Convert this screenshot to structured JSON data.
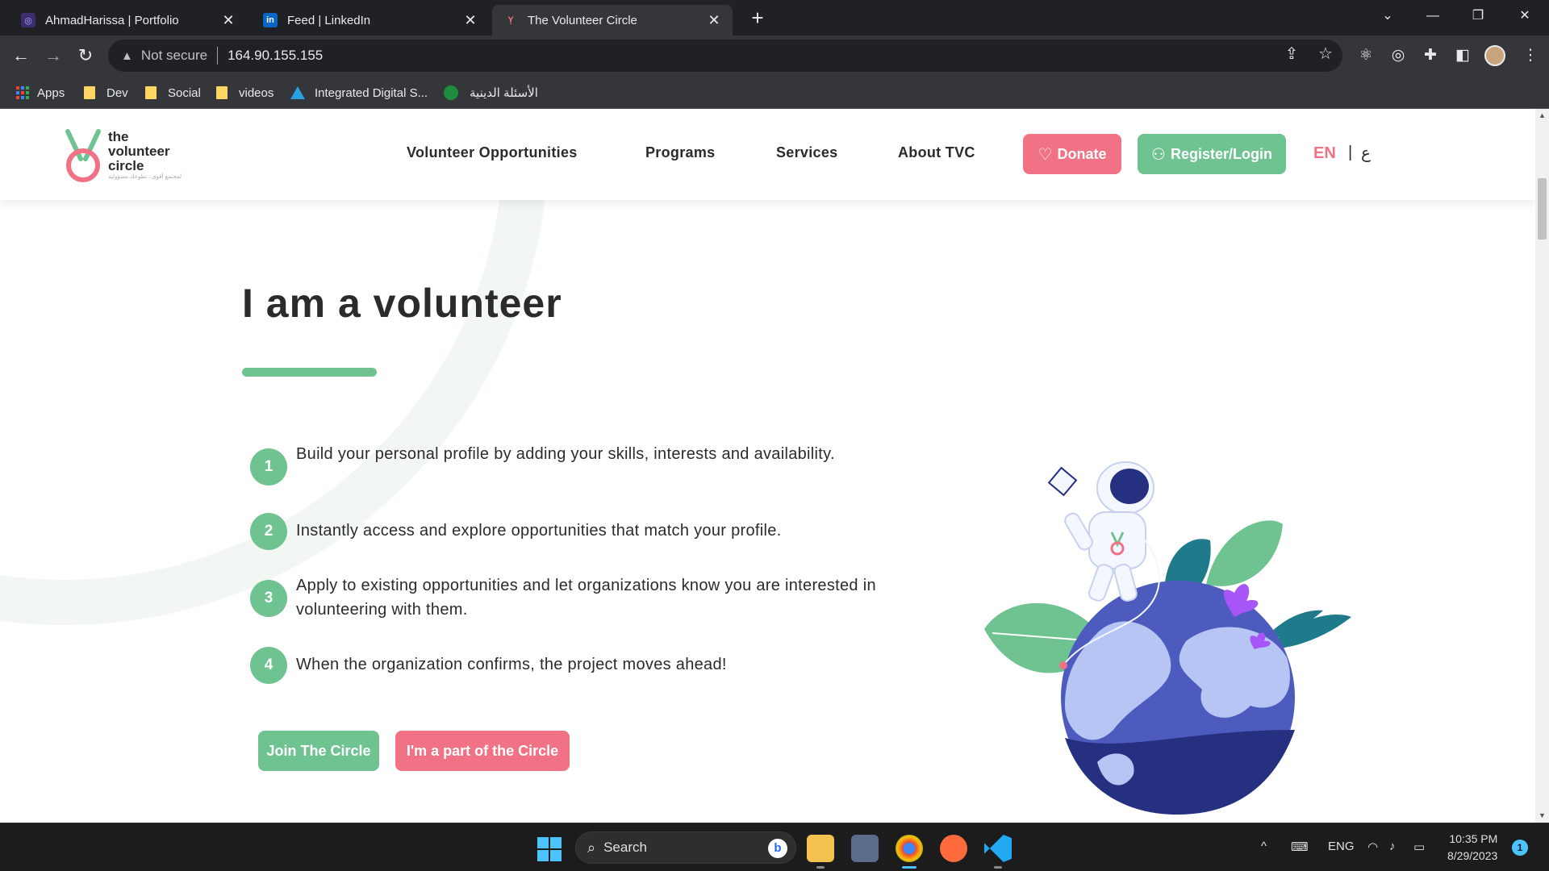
{
  "browser": {
    "tabs": [
      {
        "title": "AhmadHarissa | Portfolio",
        "icon": "portfolio-favicon"
      },
      {
        "title": "Feed | LinkedIn",
        "icon": "linkedin-favicon"
      },
      {
        "title": "The Volunteer Circle",
        "icon": "tvc-favicon"
      }
    ],
    "address": {
      "security_label": "Not secure",
      "url": "164.90.155.155"
    },
    "bookmarks": [
      "Apps",
      "Dev",
      "Social",
      "videos",
      "Integrated Digital S...",
      "الأسئلة الدينية"
    ]
  },
  "site": {
    "logo": {
      "line1": "the",
      "line2": "volunteer",
      "line3": "circle",
      "tagline_ar": "لمجتمع أقوى.. تطوعك مسؤولية"
    },
    "nav": [
      "Volunteer Opportunities",
      "Programs",
      "Services",
      "About TVC"
    ],
    "donate_label": "Donate",
    "login_label": "Register/Login",
    "lang_en": "EN",
    "lang_sep": "|",
    "lang_ar": "ع"
  },
  "hero": {
    "title": "I am a volunteer",
    "steps": [
      {
        "num": "1",
        "text": "Build your personal profile by adding your skills, interests and availability."
      },
      {
        "num": "2",
        "text": "Instantly access and explore opportunities that match your profile."
      },
      {
        "num": "3",
        "text": "Apply to existing opportunities and let organizations know you are interested in volunteering with them."
      },
      {
        "num": "4",
        "text": "When the organization confirms, the project moves ahead!"
      }
    ],
    "join_label": "Join The Circle",
    "part_label": "I'm a part of the Circle"
  },
  "taskbar": {
    "search_label": "Search",
    "bing_label": "b",
    "lang": "ENG",
    "time": "10:35 PM",
    "date": "8/29/2023",
    "notifications": "1"
  },
  "colors": {
    "green": "#6ec391",
    "pink": "#f07284",
    "text": "#2b2b2b",
    "chrome": "#35363a"
  }
}
